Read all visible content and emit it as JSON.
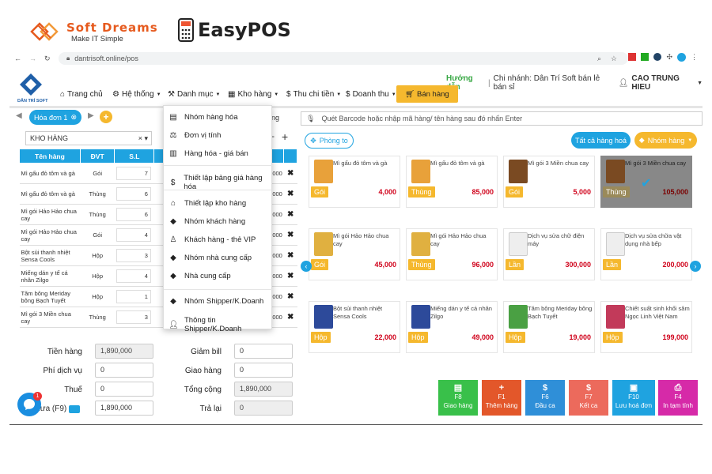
{
  "brand": {
    "softdreams": "Soft Dreams",
    "tagline": "Make IT Simple",
    "easypos": "EasyPOS"
  },
  "browser": {
    "url": "dantrisoft.online/pos"
  },
  "nav": {
    "logo_text": "DÂN TRÍ SOFT",
    "help": "Hướng dẫn",
    "branch": "Chi nhánh: Dân Trí Soft bán lẻ bán sỉ",
    "user": "CAO TRUNG HIEU",
    "items": [
      "Trang chủ",
      "Hệ thống",
      "Danh mục",
      "Kho hàng",
      "Thu chi tiền",
      "Doanh thu"
    ],
    "sale_button": "Bán hàng"
  },
  "invoice_tab": "Hóa đơn 1",
  "hidden_fragment": "ng",
  "warehouse": "KHO HÀNG",
  "cart": {
    "headers": [
      "Tên hàng",
      "ĐVT",
      "S.L"
    ],
    "rows": [
      {
        "name": "Mì gấu đỏ tôm và gà",
        "unit": "Gói",
        "qty": "7",
        "total": ",000"
      },
      {
        "name": "Mì gấu đỏ tôm và gà",
        "unit": "Thùng",
        "qty": "6",
        "total": ",000"
      },
      {
        "name": "Mì gói Hảo Hảo chua cay",
        "unit": "Thùng",
        "qty": "6",
        "total": ",000"
      },
      {
        "name": "Mì gói Hảo Hảo chua cay",
        "unit": "Gói",
        "qty": "4",
        "total": ",000"
      },
      {
        "name": "Bột sủi thanh nhiệt Sensa Cools",
        "unit": "Hộp",
        "qty": "3",
        "total": ",000"
      },
      {
        "name": "Miếng dán y tế cá nhân Zilgo",
        "unit": "Hộp",
        "qty": "4",
        "total": ",000"
      },
      {
        "name": "Tăm bông Meriday bông Bạch Tuyết",
        "unit": "Hộp",
        "qty": "1",
        "total": ",000"
      },
      {
        "name": "Mì gói 3 Miền chua cay",
        "unit": "Thùng",
        "qty": "3",
        "total": ",000"
      }
    ]
  },
  "menu": {
    "items": [
      "Nhóm hàng hóa",
      "Đơn vị tính",
      "Hàng hóa - giá bán",
      "Thiết lập bảng giá hàng hóa",
      "Thiết lập kho hàng",
      "Nhóm khách hàng",
      "Khách hàng - thẻ VIP",
      "Nhóm nhà cung cấp",
      "Nhà cung cấp",
      "Nhóm Shipper/K.Doanh",
      "Thông tin Shipper/K.Doanh"
    ]
  },
  "totals": {
    "tien_hang_label": "Tiền hàng",
    "tien_hang": "1,890,000",
    "phi_dv_label": "Phí dịch vụ",
    "phi_dv": "0",
    "thue_label": "Thuế",
    "thue": "0",
    "khach_dua_label": "ch đưa (F9)",
    "khach_dua": "1,890,000",
    "giam_bill_label": "Giảm bill",
    "giam_bill": "0",
    "giao_hang_label": "Giao hàng",
    "giao_hang": "0",
    "tong_cong_label": "Tổng cộng",
    "tong_cong": "1,890,000",
    "tra_lai_label": "Trả lại",
    "tra_lai": "0"
  },
  "chat_badge": "1",
  "search": {
    "placeholder": "Quét Barcode hoặc nhập mã hàng/ tên hàng sau đó nhấn Enter"
  },
  "buttons": {
    "room": "Phòng to",
    "all_products": "Tất cả hàng hoá",
    "product_group": "Nhóm hàng"
  },
  "products": [
    {
      "name": "Mì gấu đỏ tôm và gà",
      "unit": "Gói",
      "price": "4,000",
      "thumb": "#e8a13a"
    },
    {
      "name": "Mì gấu đỏ tôm và gà",
      "unit": "Thùng",
      "price": "85,000",
      "thumb": "#e8a13a"
    },
    {
      "name": "Mì gói 3 Miền chua cay",
      "unit": "Gói",
      "price": "5,000",
      "thumb": "#7a4a22"
    },
    {
      "name": "Mì gói 3 Miền chua cay",
      "unit": "Thùng",
      "price": "105,000",
      "thumb": "#7a4a22"
    },
    {
      "name": "Mì gói Hảo Hảo chua cay",
      "unit": "Gói",
      "price": "45,000",
      "thumb": "#e0b040"
    },
    {
      "name": "Mì gói Hảo Hảo chua cay",
      "unit": "Thùng",
      "price": "96,000",
      "thumb": "#e0b040"
    },
    {
      "name": "Dịch vụ sửa chữ điện máy",
      "unit": "Lần",
      "price": "300,000",
      "thumb": "#eee"
    },
    {
      "name": "Dịch vụ sửa chữa vật dụng nhà bếp",
      "unit": "Lần",
      "price": "200,000",
      "thumb": "#eee"
    },
    {
      "name": "Bột sủi thanh nhiệt Sensa Cools",
      "unit": "Hộp",
      "price": "22,000",
      "thumb": "#2d4a9a"
    },
    {
      "name": "Miếng dán y tế cá nhân Zilgo",
      "unit": "Hộp",
      "price": "49,000",
      "thumb": "#2d4a9a"
    },
    {
      "name": "Tăm bông Meriday bông Bạch Tuyết",
      "unit": "Hộp",
      "price": "19,000",
      "thumb": "#4aa043"
    },
    {
      "name": "Chiết suất sinh khối sâm Ngọc Linh Việt Nam",
      "unit": "Hộp",
      "price": "199,000",
      "thumb": "#c23a5a"
    }
  ],
  "fkeys": [
    {
      "key": "F8",
      "label": "Giao hàng",
      "color": "#39c04a",
      "icon": "▤"
    },
    {
      "key": "F1",
      "label": "Thêm hàng",
      "color": "#e3572a",
      "icon": "+"
    },
    {
      "key": "F6",
      "label": "Đầu ca",
      "color": "#2f8fd8",
      "icon": "$"
    },
    {
      "key": "F7",
      "label": "Kết ca",
      "color": "#ec6a5c",
      "icon": "$"
    },
    {
      "key": "F10",
      "label": "Lưu hoá đơn",
      "color": "#1fa3e0",
      "icon": "▣"
    },
    {
      "key": "F4",
      "label": "In tạm tính",
      "color": "#d62aa8",
      "icon": "⎙"
    }
  ]
}
